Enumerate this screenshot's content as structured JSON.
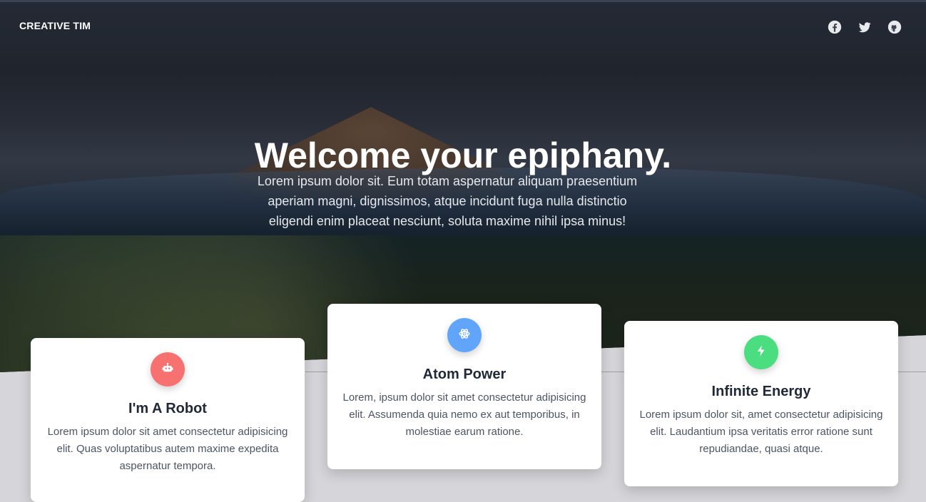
{
  "nav": {
    "brand": "CREATIVE TIM",
    "social": [
      {
        "icon": "facebook-icon"
      },
      {
        "icon": "twitter-icon"
      },
      {
        "icon": "github-icon"
      }
    ]
  },
  "hero": {
    "title": "Welcome your epiphany.",
    "description": "Lorem ipsum dolor sit. Eum totam aspernatur aliquam praesentium aperiam magni, dignissimos, atque incidunt fuga nulla distinctio eligendi enim placeat nesciunt, soluta maxime nihil ipsa minus!"
  },
  "features": [
    {
      "icon": "robot-icon",
      "color": "#f87171",
      "title": "I'm A Robot",
      "text": "Lorem ipsum dolor sit amet consectetur adipisicing elit. Quas voluptatibus autem maxime expedita aspernatur tempora."
    },
    {
      "icon": "atom-icon",
      "color": "#60a5fa",
      "title": "Atom Power",
      "text": "Lorem, ipsum dolor sit amet consectetur adipisicing elit. Assumenda quia nemo ex aut temporibus, in molestiae earum ratione."
    },
    {
      "icon": "bolt-icon",
      "color": "#4ade80",
      "title": "Infinite Energy",
      "text": "Lorem ipsum dolor sit, amet consectetur adipisicing elit. Laudantium ipsa veritatis error ratione sunt repudiandae, quasi atque."
    }
  ]
}
